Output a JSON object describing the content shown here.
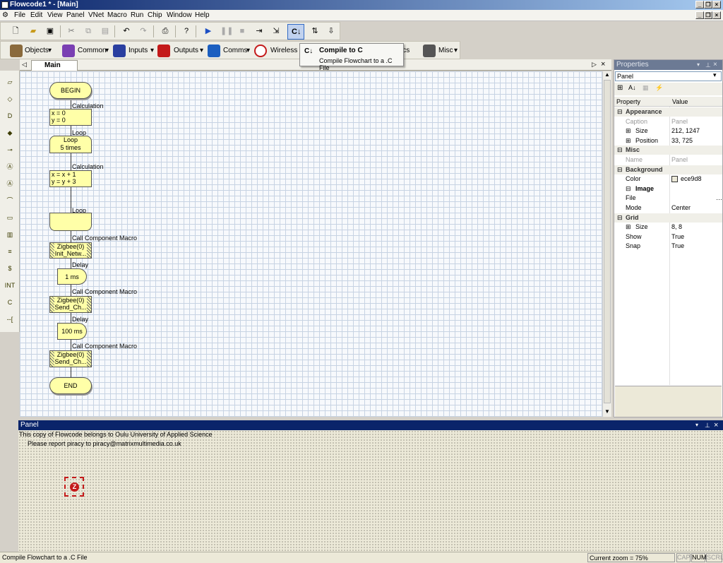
{
  "window": {
    "title": "Flowcode1 * - [Main]"
  },
  "menu": [
    "File",
    "Edit",
    "View",
    "Panel",
    "VNet",
    "Macro",
    "Run",
    "Chip",
    "Window",
    "Help"
  ],
  "toolbar2": {
    "objects": "Objects",
    "common": "Common",
    "inputs": "Inputs",
    "outputs": "Outputs",
    "comms": "Comms",
    "wireless": "Wireless",
    "hidden_tail": "ics",
    "misc": "Misc"
  },
  "tooltip": {
    "title": "Compile to C",
    "body": "Compile Flowchart to a .C File"
  },
  "tab": {
    "label": "Main"
  },
  "flowchart": {
    "begin": "BEGIN",
    "calc1_label": "Calculation",
    "calc1_line1": "x = 0",
    "calc1_line2": "y = 0",
    "loop_label": "Loop",
    "loop_box_line1": "Loop",
    "loop_box_line2": "5 times",
    "calc2_label": "Calculation",
    "calc2_line1": "x = x + 1",
    "calc2_line2": "y = y + 3",
    "loop_end_label": "Loop",
    "macro1_label": "Call Component Macro",
    "macro1_line1": "Zigbee(0)",
    "macro1_line2": "Init_Netw...",
    "delay1_label": "Delay",
    "delay1_text": "1 ms",
    "macro2_label": "Call Component Macro",
    "macro2_line1": "Zigbee(0)",
    "macro2_line2": "Send_Ch...",
    "delay2_label": "Delay",
    "delay2_text": "100 ms",
    "macro3_label": "Call Component Macro",
    "macro3_line1": "Zigbee(0)",
    "macro3_line2": "Send_Ch...",
    "end": "END"
  },
  "properties": {
    "header": "Properties",
    "selector": "Panel",
    "col_property": "Property",
    "col_value": "Value",
    "rows": [
      {
        "kind": "cat",
        "name": "Appearance"
      },
      {
        "kind": "ro",
        "name": "Caption",
        "value": "Panel"
      },
      {
        "kind": "exp",
        "name": "Size",
        "value": "212, 1247"
      },
      {
        "kind": "exp",
        "name": "Position",
        "value": "33, 725"
      },
      {
        "kind": "cat",
        "name": "Misc"
      },
      {
        "kind": "ro",
        "name": "Name",
        "value": "Panel"
      },
      {
        "kind": "cat",
        "name": "Background"
      },
      {
        "kind": "prop",
        "name": "Color",
        "value": "ece9d8"
      },
      {
        "kind": "sub",
        "name": "Image"
      },
      {
        "kind": "prop",
        "name": "File",
        "value": ""
      },
      {
        "kind": "prop",
        "name": "Mode",
        "value": "Center"
      },
      {
        "kind": "cat",
        "name": "Grid"
      },
      {
        "kind": "exp",
        "name": "Size",
        "value": "8, 8"
      },
      {
        "kind": "prop",
        "name": "Show",
        "value": "True"
      },
      {
        "kind": "prop",
        "name": "Snap",
        "value": "True"
      }
    ]
  },
  "panel": {
    "title": "Panel",
    "line1": "This copy of Flowcode belongs to Oulu University of Applied Science",
    "line2": "Please report piracy to piracy@matrixmultimedia.co.uk"
  },
  "status": {
    "message": "Compile Flowchart to a .C File",
    "zoom": "Current zoom = 75%",
    "cap": "CAP",
    "num": "NUM",
    "scrl": "SCRL"
  },
  "colors": {
    "panel_bg": "#ece9d8",
    "title_bar": "#0a246a",
    "flow_fill": "#ffffa8"
  }
}
